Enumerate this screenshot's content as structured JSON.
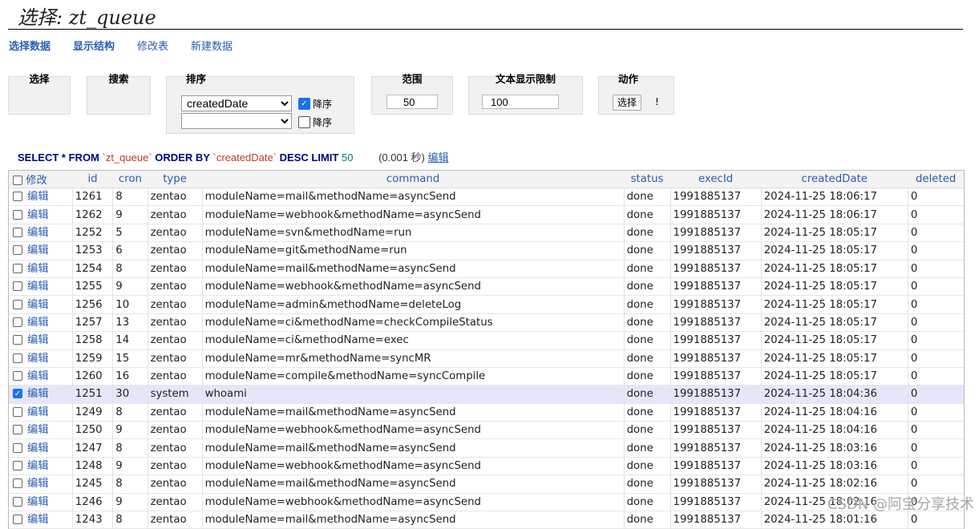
{
  "page_title": "选择: zt_queue",
  "nav": [
    "选择数据",
    "显示结构",
    "修改表",
    "新建数据"
  ],
  "panels": {
    "select": {
      "legend": "选择"
    },
    "search": {
      "legend": "搜索"
    },
    "sort": {
      "legend": "排序",
      "field1": "createdDate",
      "desc_label": "降序",
      "desc1_checked": true,
      "field2": "",
      "desc2_checked": false
    },
    "range": {
      "legend": "范围",
      "value": "50"
    },
    "textlimit": {
      "legend": "文本显示限制",
      "value": "100"
    },
    "action": {
      "legend": "动作",
      "button": "选择",
      "mark": "!"
    }
  },
  "sql": {
    "select": "SELECT",
    "star": "*",
    "from": "FROM",
    "table": "`zt_queue`",
    "order": "ORDER BY",
    "col": "`createdDate`",
    "desc": "DESC",
    "limit": "LIMIT",
    "limit_n": "50",
    "time": "(0.001 秒)",
    "edit_link": "编辑"
  },
  "table": {
    "headers": [
      "修改",
      "id",
      "cron",
      "type",
      "command",
      "status",
      "execId",
      "createdDate",
      "deleted"
    ],
    "edit_label": "编辑",
    "rows": [
      {
        "id": "1261",
        "cron": "8",
        "type": "zentao",
        "command": "moduleName=mail&methodName=asyncSend",
        "status": "done",
        "execId": "1991885137",
        "createdDate": "2024-11-25 18:06:17",
        "deleted": "0",
        "checked": false
      },
      {
        "id": "1262",
        "cron": "9",
        "type": "zentao",
        "command": "moduleName=webhook&methodName=asyncSend",
        "status": "done",
        "execId": "1991885137",
        "createdDate": "2024-11-25 18:06:17",
        "deleted": "0",
        "checked": false
      },
      {
        "id": "1252",
        "cron": "5",
        "type": "zentao",
        "command": "moduleName=svn&methodName=run",
        "status": "done",
        "execId": "1991885137",
        "createdDate": "2024-11-25 18:05:17",
        "deleted": "0",
        "checked": false
      },
      {
        "id": "1253",
        "cron": "6",
        "type": "zentao",
        "command": "moduleName=git&methodName=run",
        "status": "done",
        "execId": "1991885137",
        "createdDate": "2024-11-25 18:05:17",
        "deleted": "0",
        "checked": false
      },
      {
        "id": "1254",
        "cron": "8",
        "type": "zentao",
        "command": "moduleName=mail&methodName=asyncSend",
        "status": "done",
        "execId": "1991885137",
        "createdDate": "2024-11-25 18:05:17",
        "deleted": "0",
        "checked": false
      },
      {
        "id": "1255",
        "cron": "9",
        "type": "zentao",
        "command": "moduleName=webhook&methodName=asyncSend",
        "status": "done",
        "execId": "1991885137",
        "createdDate": "2024-11-25 18:05:17",
        "deleted": "0",
        "checked": false
      },
      {
        "id": "1256",
        "cron": "10",
        "type": "zentao",
        "command": "moduleName=admin&methodName=deleteLog",
        "status": "done",
        "execId": "1991885137",
        "createdDate": "2024-11-25 18:05:17",
        "deleted": "0",
        "checked": false
      },
      {
        "id": "1257",
        "cron": "13",
        "type": "zentao",
        "command": "moduleName=ci&methodName=checkCompileStatus",
        "status": "done",
        "execId": "1991885137",
        "createdDate": "2024-11-25 18:05:17",
        "deleted": "0",
        "checked": false
      },
      {
        "id": "1258",
        "cron": "14",
        "type": "zentao",
        "command": "moduleName=ci&methodName=exec",
        "status": "done",
        "execId": "1991885137",
        "createdDate": "2024-11-25 18:05:17",
        "deleted": "0",
        "checked": false
      },
      {
        "id": "1259",
        "cron": "15",
        "type": "zentao",
        "command": "moduleName=mr&methodName=syncMR",
        "status": "done",
        "execId": "1991885137",
        "createdDate": "2024-11-25 18:05:17",
        "deleted": "0",
        "checked": false
      },
      {
        "id": "1260",
        "cron": "16",
        "type": "zentao",
        "command": "moduleName=compile&methodName=syncCompile",
        "status": "done",
        "execId": "1991885137",
        "createdDate": "2024-11-25 18:05:17",
        "deleted": "0",
        "checked": false
      },
      {
        "id": "1251",
        "cron": "30",
        "type": "system",
        "command": "whoami",
        "status": "done",
        "execId": "1991885137",
        "createdDate": "2024-11-25 18:04:36",
        "deleted": "0",
        "checked": true
      },
      {
        "id": "1249",
        "cron": "8",
        "type": "zentao",
        "command": "moduleName=mail&methodName=asyncSend",
        "status": "done",
        "execId": "1991885137",
        "createdDate": "2024-11-25 18:04:16",
        "deleted": "0",
        "checked": false
      },
      {
        "id": "1250",
        "cron": "9",
        "type": "zentao",
        "command": "moduleName=webhook&methodName=asyncSend",
        "status": "done",
        "execId": "1991885137",
        "createdDate": "2024-11-25 18:04:16",
        "deleted": "0",
        "checked": false
      },
      {
        "id": "1247",
        "cron": "8",
        "type": "zentao",
        "command": "moduleName=mail&methodName=asyncSend",
        "status": "done",
        "execId": "1991885137",
        "createdDate": "2024-11-25 18:03:16",
        "deleted": "0",
        "checked": false
      },
      {
        "id": "1248",
        "cron": "9",
        "type": "zentao",
        "command": "moduleName=webhook&methodName=asyncSend",
        "status": "done",
        "execId": "1991885137",
        "createdDate": "2024-11-25 18:03:16",
        "deleted": "0",
        "checked": false
      },
      {
        "id": "1245",
        "cron": "8",
        "type": "zentao",
        "command": "moduleName=mail&methodName=asyncSend",
        "status": "done",
        "execId": "1991885137",
        "createdDate": "2024-11-25 18:02:16",
        "deleted": "0",
        "checked": false
      },
      {
        "id": "1246",
        "cron": "9",
        "type": "zentao",
        "command": "moduleName=webhook&methodName=asyncSend",
        "status": "done",
        "execId": "1991885137",
        "createdDate": "2024-11-25 18:02:16",
        "deleted": "0",
        "checked": false
      },
      {
        "id": "1243",
        "cron": "8",
        "type": "zentao",
        "command": "moduleName=mail&methodName=asyncSend",
        "status": "done",
        "execId": "1991885137",
        "createdDate": "2024-11-25 18:01:16",
        "deleted": "0",
        "checked": false
      }
    ]
  },
  "watermark": "CSDN @阿宝分享技术",
  "colors": {
    "link": "#2a5db0",
    "selected_row": "#e6e6fa",
    "keyword": "#000080",
    "string": "#c0392b"
  }
}
